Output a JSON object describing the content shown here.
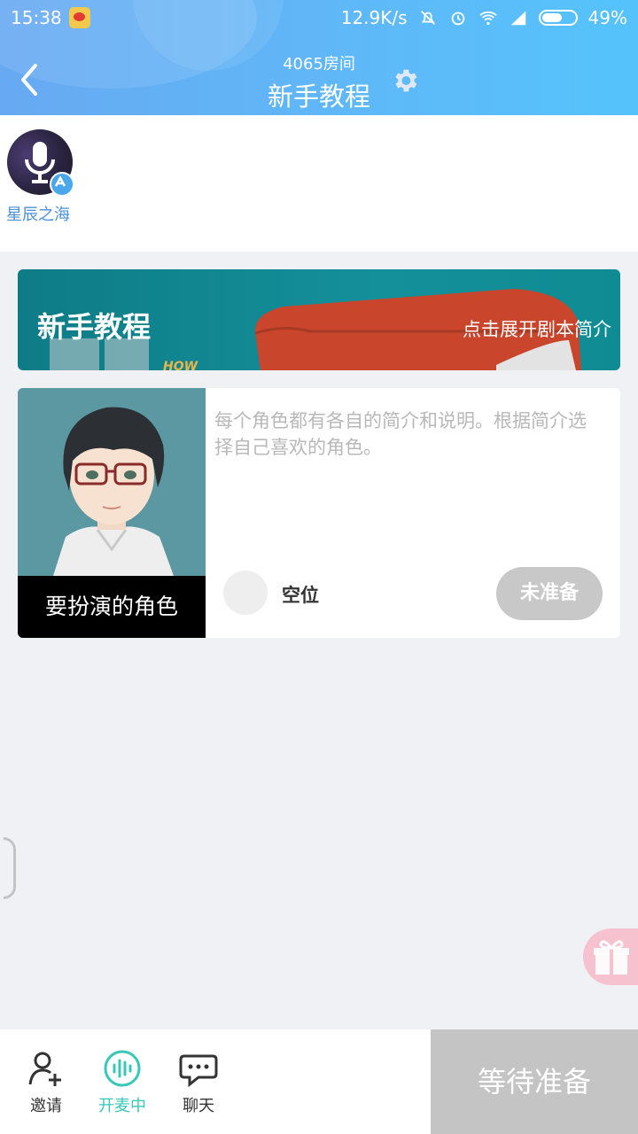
{
  "status_bar": {
    "time": "15:38",
    "net_speed": "12.9K/s",
    "battery": "49%"
  },
  "header": {
    "room_number": "4065房间",
    "title": "新手教程"
  },
  "host": {
    "name": "星辰之海"
  },
  "script_banner": {
    "title": "新手教程",
    "expand_link": "点击展开剧本简介"
  },
  "role_card": {
    "caption": "要扮演的角色",
    "description": "每个角色都有各自的简介和说明。根据简介选择自己喜欢的角色。",
    "slot_label": "空位",
    "ready_button": "未准备"
  },
  "bottom_bar": {
    "tabs": [
      {
        "label": "邀请",
        "icon": "invite-user-icon"
      },
      {
        "label": "开麦中",
        "icon": "voice-wave-icon"
      },
      {
        "label": "聊天",
        "icon": "chat-bubble-icon"
      }
    ],
    "wait_button": "等待准备"
  },
  "colors": {
    "header_gradient_start": "#67a9f2",
    "header_gradient_end": "#55c3fb",
    "accent_teal": "#39c7b8",
    "link_blue": "#4a90d9",
    "disabled_gray": "#c4c4c4"
  }
}
